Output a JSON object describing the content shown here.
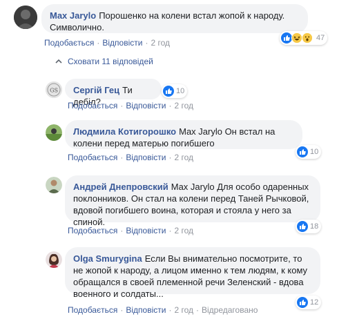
{
  "top_comment": {
    "author": "Max Jarylo",
    "text": "Порошенко на колени встал жопой к народу. Символично.",
    "like_label": "Подобається",
    "reply_label": "Відповісти",
    "time": "2 год",
    "reactions": [
      "like",
      "haha",
      "wow"
    ],
    "reaction_count": "47"
  },
  "replies_toggle": {
    "label": "Сховати 11 відповідей",
    "icon": "chevron-up-icon"
  },
  "replies": [
    {
      "author": "Сергій Гец",
      "text": "Ти дебіл?",
      "like_label": "Подобається",
      "reply_label": "Відповісти",
      "time": "2 год",
      "reaction_count": "10",
      "avatar_initials": "GS"
    },
    {
      "author": "Людмила Котигорошко",
      "text": "Max Jarylo Он встал на колени перед матерью погибшего",
      "like_label": "Подобається",
      "reply_label": "Відповісти",
      "time": "2 год",
      "reaction_count": "10"
    },
    {
      "author": "Андрей Днепровский",
      "text": "Max Jarylo Для особо одаренных поклонников. Он стал на колени перед Таней Рычковой, вдовой погибшего воина, которая и стояла у него за спиной.",
      "like_label": "Подобається",
      "reply_label": "Відповісти",
      "time": "2 год",
      "reaction_count": "18"
    },
    {
      "author": "Olga Smurygina",
      "text": "Если Вы внимательно посмотрите, то не жопой к народу, а лицом именно к тем людям, к кому обращался в своей племенной речи Зеленский - вдова военного и солдаты...",
      "like_label": "Подобається",
      "reply_label": "Відповісти",
      "time": "2 год",
      "edited": "Відредаговано",
      "reaction_count": "12"
    }
  ],
  "colors": {
    "link": "#385898",
    "bubble": "#f2f3f5",
    "like_blue": "#1877f2"
  }
}
